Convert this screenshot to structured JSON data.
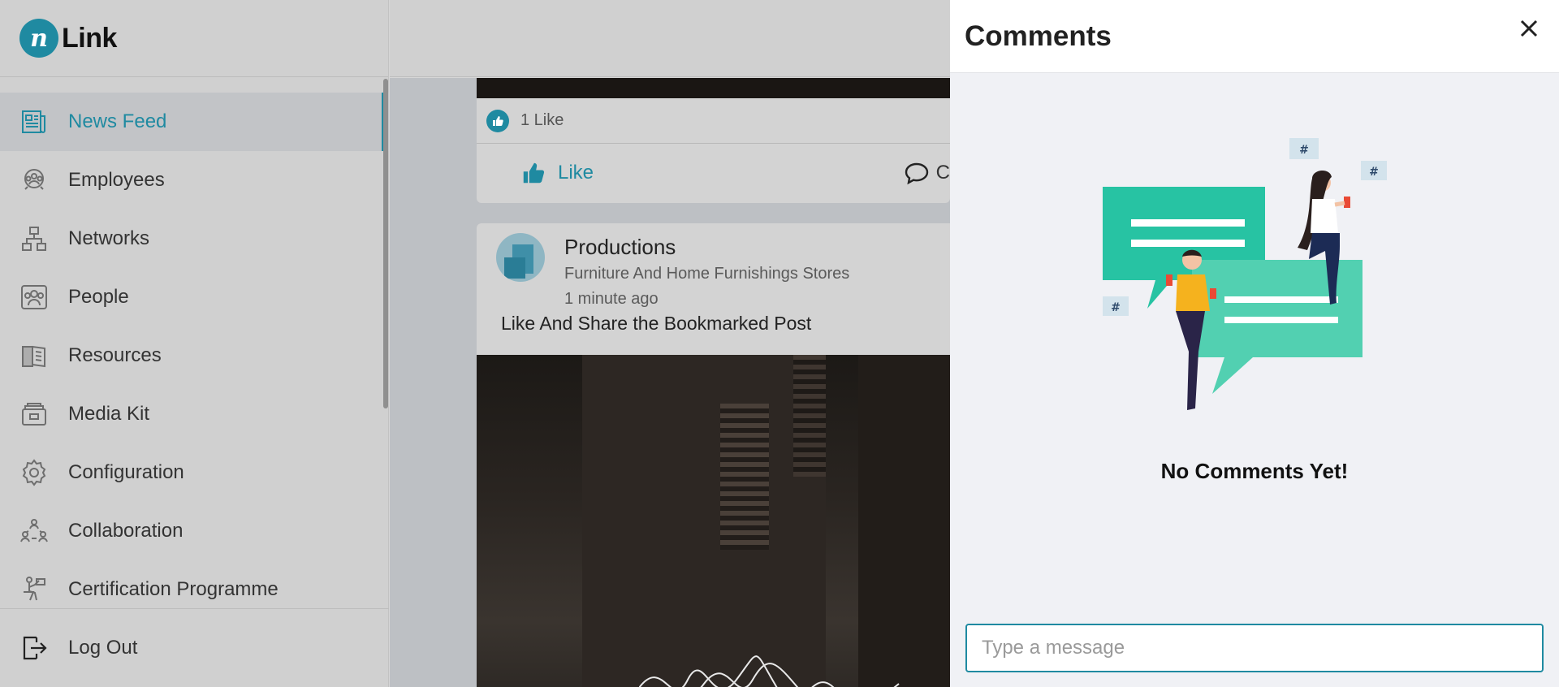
{
  "brand": {
    "mark": "n",
    "name": "Link"
  },
  "sidebar": {
    "items": [
      {
        "label": "News Feed",
        "icon": "newspaper-icon",
        "active": true
      },
      {
        "label": "Employees",
        "icon": "employees-icon",
        "active": false
      },
      {
        "label": "Networks",
        "icon": "network-icon",
        "active": false
      },
      {
        "label": "People",
        "icon": "people-icon",
        "active": false
      },
      {
        "label": "Resources",
        "icon": "book-icon",
        "active": false
      },
      {
        "label": "Media Kit",
        "icon": "media-kit-icon",
        "active": false
      },
      {
        "label": "Configuration",
        "icon": "gear-icon",
        "active": false
      },
      {
        "label": "Collaboration",
        "icon": "collaboration-icon",
        "active": false
      },
      {
        "label": "Certification Programme",
        "icon": "certification-icon",
        "active": false
      }
    ],
    "logout_label": "Log Out"
  },
  "feed": {
    "previous_post": {
      "likes_label": "1 Like",
      "like_button": "Like",
      "comment_button": "C"
    },
    "post": {
      "author": "Productions",
      "category": "Furniture And Home Furnishings Stores",
      "time": "1 minute ago",
      "text": "Like And Share the Bookmarked Post"
    }
  },
  "comments_panel": {
    "title": "Comments",
    "empty_text": "No Comments Yet!",
    "input_placeholder": "Type a message"
  },
  "colors": {
    "accent": "#1f8aa1",
    "panel_bg": "#f0f1f5",
    "overlay": "#d0d0d0"
  }
}
